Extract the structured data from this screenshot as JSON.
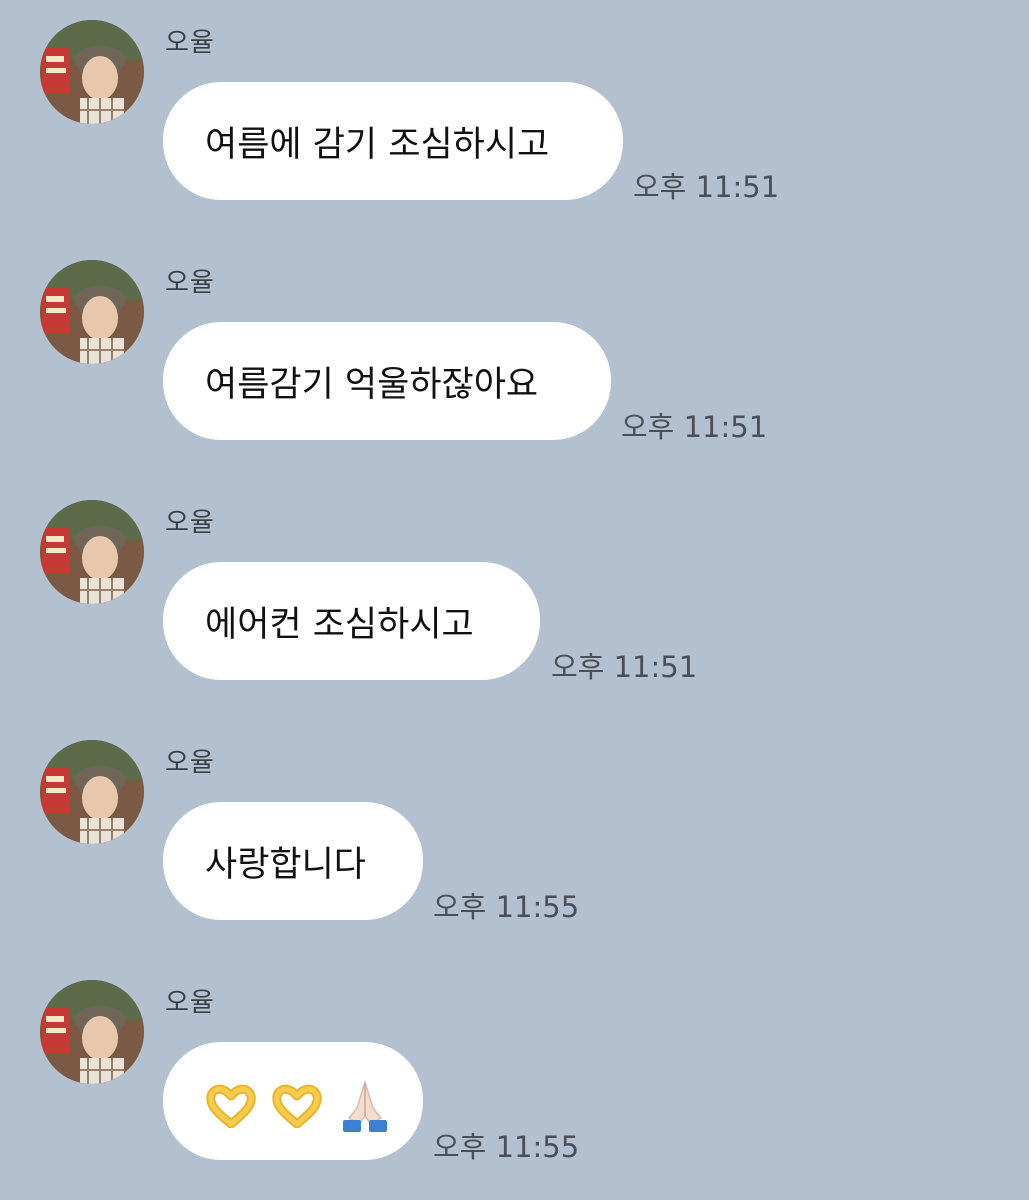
{
  "chat": {
    "messages": [
      {
        "sender": "오율",
        "text": "여름에 감기 조심하시고",
        "time": "오후 11:51"
      },
      {
        "sender": "오율",
        "text": "여름감기 억울하잖아요",
        "time": "오후 11:51"
      },
      {
        "sender": "오율",
        "text": "에어컨 조심하시고",
        "time": "오후 11:51"
      },
      {
        "sender": "오율",
        "text": "사랑합니다",
        "time": "오후 11:55"
      },
      {
        "sender": "오율",
        "emojis": [
          "heart-hands-icon",
          "heart-hands-icon",
          "folded-hands-icon"
        ],
        "time": "오후 11:55"
      }
    ]
  },
  "colors": {
    "background": "#b2c0d0",
    "bubble": "#ffffff",
    "text": "#111111",
    "timestamp": "#4a4f57"
  }
}
